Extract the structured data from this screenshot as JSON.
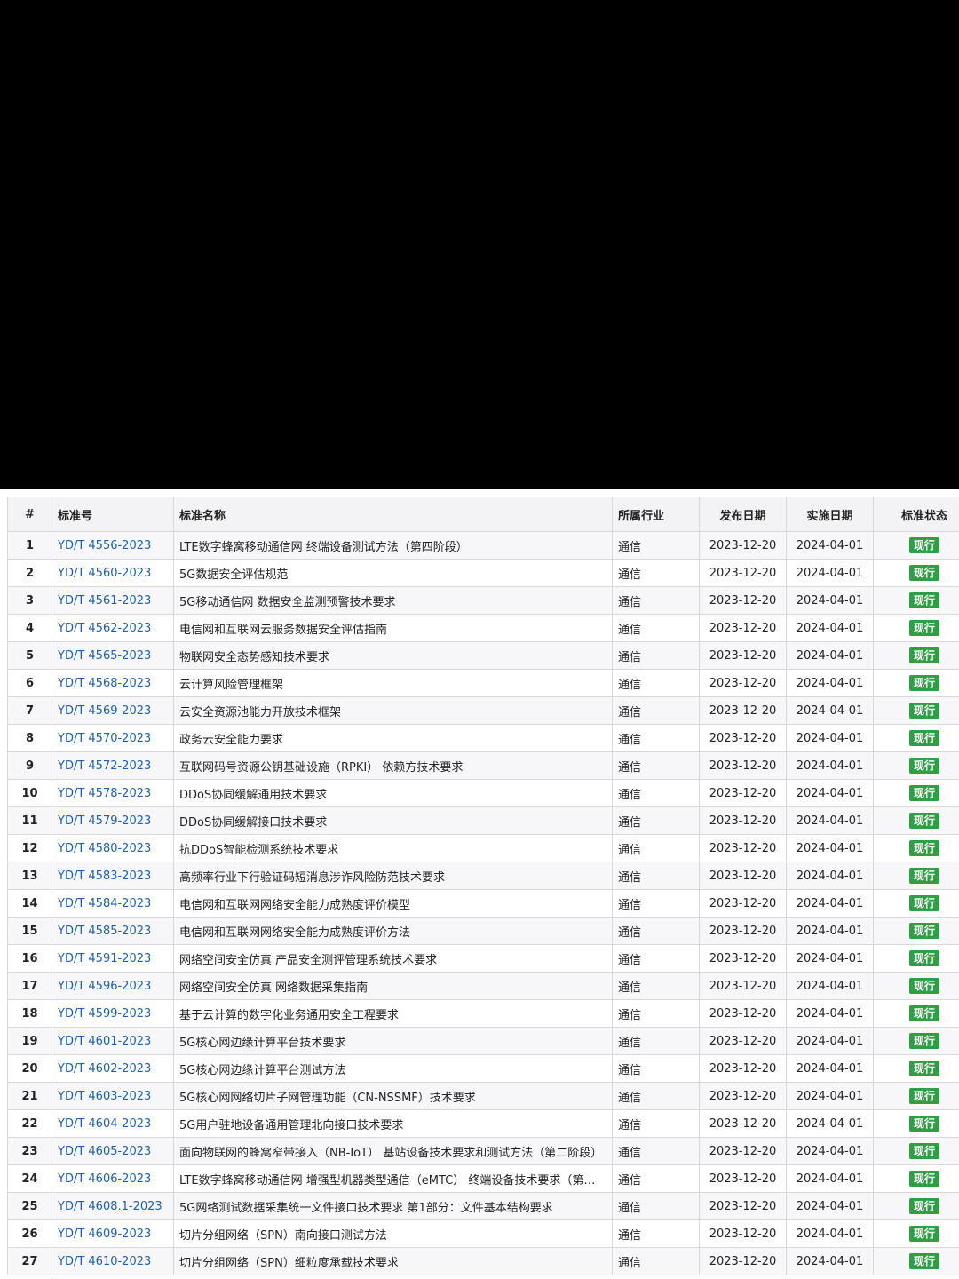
{
  "table": {
    "headers": [
      "#",
      "标准号",
      "标准名称",
      "所属行业",
      "发布日期",
      "实施日期",
      "标准状态"
    ],
    "rows": [
      {
        "idx": "1",
        "code": "YD/T 4556-2023",
        "name": "LTE数字蜂窝移动通信网 终端设备测试方法（第四阶段）",
        "industry": "通信",
        "publish": "2023-12-20",
        "implement": "2024-04-01",
        "status": "现行"
      },
      {
        "idx": "2",
        "code": "YD/T 4560-2023",
        "name": "5G数据安全评估规范",
        "industry": "通信",
        "publish": "2023-12-20",
        "implement": "2024-04-01",
        "status": "现行"
      },
      {
        "idx": "3",
        "code": "YD/T 4561-2023",
        "name": "5G移动通信网 数据安全监测预警技术要求",
        "industry": "通信",
        "publish": "2023-12-20",
        "implement": "2024-04-01",
        "status": "现行"
      },
      {
        "idx": "4",
        "code": "YD/T 4562-2023",
        "name": "电信网和互联网云服务数据安全评估指南",
        "industry": "通信",
        "publish": "2023-12-20",
        "implement": "2024-04-01",
        "status": "现行"
      },
      {
        "idx": "5",
        "code": "YD/T 4565-2023",
        "name": "物联网安全态势感知技术要求",
        "industry": "通信",
        "publish": "2023-12-20",
        "implement": "2024-04-01",
        "status": "现行"
      },
      {
        "idx": "6",
        "code": "YD/T 4568-2023",
        "name": "云计算风险管理框架",
        "industry": "通信",
        "publish": "2023-12-20",
        "implement": "2024-04-01",
        "status": "现行"
      },
      {
        "idx": "7",
        "code": "YD/T 4569-2023",
        "name": "云安全资源池能力开放技术框架",
        "industry": "通信",
        "publish": "2023-12-20",
        "implement": "2024-04-01",
        "status": "现行"
      },
      {
        "idx": "8",
        "code": "YD/T 4570-2023",
        "name": "政务云安全能力要求",
        "industry": "通信",
        "publish": "2023-12-20",
        "implement": "2024-04-01",
        "status": "现行"
      },
      {
        "idx": "9",
        "code": "YD/T 4572-2023",
        "name": "互联网码号资源公钥基础设施（RPKI） 依赖方技术要求",
        "industry": "通信",
        "publish": "2023-12-20",
        "implement": "2024-04-01",
        "status": "现行"
      },
      {
        "idx": "10",
        "code": "YD/T 4578-2023",
        "name": "DDoS协同缓解通用技术要求",
        "industry": "通信",
        "publish": "2023-12-20",
        "implement": "2024-04-01",
        "status": "现行"
      },
      {
        "idx": "11",
        "code": "YD/T 4579-2023",
        "name": "DDoS协同缓解接口技术要求",
        "industry": "通信",
        "publish": "2023-12-20",
        "implement": "2024-04-01",
        "status": "现行"
      },
      {
        "idx": "12",
        "code": "YD/T 4580-2023",
        "name": "抗DDoS智能检测系统技术要求",
        "industry": "通信",
        "publish": "2023-12-20",
        "implement": "2024-04-01",
        "status": "现行"
      },
      {
        "idx": "13",
        "code": "YD/T 4583-2023",
        "name": "高频率行业下行验证码短消息涉诈风险防范技术要求",
        "industry": "通信",
        "publish": "2023-12-20",
        "implement": "2024-04-01",
        "status": "现行"
      },
      {
        "idx": "14",
        "code": "YD/T 4584-2023",
        "name": "电信网和互联网网络安全能力成熟度评价模型",
        "industry": "通信",
        "publish": "2023-12-20",
        "implement": "2024-04-01",
        "status": "现行"
      },
      {
        "idx": "15",
        "code": "YD/T 4585-2023",
        "name": "电信网和互联网网络安全能力成熟度评价方法",
        "industry": "通信",
        "publish": "2023-12-20",
        "implement": "2024-04-01",
        "status": "现行"
      },
      {
        "idx": "16",
        "code": "YD/T 4591-2023",
        "name": "网络空间安全仿真 产品安全测评管理系统技术要求",
        "industry": "通信",
        "publish": "2023-12-20",
        "implement": "2024-04-01",
        "status": "现行"
      },
      {
        "idx": "17",
        "code": "YD/T 4596-2023",
        "name": "网络空间安全仿真 网络数据采集指南",
        "industry": "通信",
        "publish": "2023-12-20",
        "implement": "2024-04-01",
        "status": "现行"
      },
      {
        "idx": "18",
        "code": "YD/T 4599-2023",
        "name": "基于云计算的数字化业务通用安全工程要求",
        "industry": "通信",
        "publish": "2023-12-20",
        "implement": "2024-04-01",
        "status": "现行"
      },
      {
        "idx": "19",
        "code": "YD/T 4601-2023",
        "name": "5G核心网边缘计算平台技术要求",
        "industry": "通信",
        "publish": "2023-12-20",
        "implement": "2024-04-01",
        "status": "现行"
      },
      {
        "idx": "20",
        "code": "YD/T 4602-2023",
        "name": "5G核心网边缘计算平台测试方法",
        "industry": "通信",
        "publish": "2023-12-20",
        "implement": "2024-04-01",
        "status": "现行"
      },
      {
        "idx": "21",
        "code": "YD/T 4603-2023",
        "name": "5G核心网网络切片子网管理功能（CN-NSSMF）技术要求",
        "industry": "通信",
        "publish": "2023-12-20",
        "implement": "2024-04-01",
        "status": "现行"
      },
      {
        "idx": "22",
        "code": "YD/T 4604-2023",
        "name": "5G用户驻地设备通用管理北向接口技术要求",
        "industry": "通信",
        "publish": "2023-12-20",
        "implement": "2024-04-01",
        "status": "现行"
      },
      {
        "idx": "23",
        "code": "YD/T 4605-2023",
        "name": "面向物联网的蜂窝窄带接入（NB-IoT） 基站设备技术要求和测试方法（第二阶段）",
        "industry": "通信",
        "publish": "2023-12-20",
        "implement": "2024-04-01",
        "status": "现行"
      },
      {
        "idx": "24",
        "code": "YD/T 4606-2023",
        "name": "LTE数字蜂窝移动通信网 增强型机器类型通信（eMTC） 终端设备技术要求（第二…",
        "industry": "通信",
        "publish": "2023-12-20",
        "implement": "2024-04-01",
        "status": "现行"
      },
      {
        "idx": "25",
        "code": "YD/T 4608.1-2023",
        "name": "5G网络测试数据采集统一文件接口技术要求 第1部分：文件基本结构要求",
        "industry": "通信",
        "publish": "2023-12-20",
        "implement": "2024-04-01",
        "status": "现行"
      },
      {
        "idx": "26",
        "code": "YD/T 4609-2023",
        "name": "切片分组网络（SPN）南向接口测试方法",
        "industry": "通信",
        "publish": "2023-12-20",
        "implement": "2024-04-01",
        "status": "现行"
      },
      {
        "idx": "27",
        "code": "YD/T 4610-2023",
        "name": "切片分组网络（SPN）细粒度承载技术要求",
        "industry": "通信",
        "publish": "2023-12-20",
        "implement": "2024-04-01",
        "status": "现行"
      }
    ]
  },
  "colors": {
    "link": "#1a5fb4",
    "badge": "#2ea043"
  }
}
